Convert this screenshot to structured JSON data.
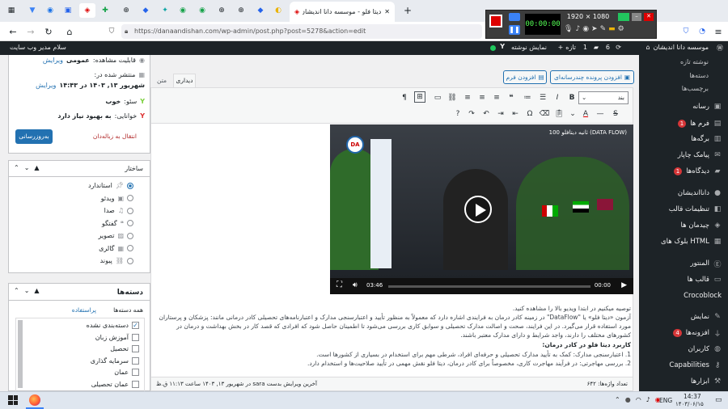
{
  "browser": {
    "active_tab_title": "دیتا فلو - موسسه دانا اندیشان",
    "url": "https://danaandishan.com/wp-admin/post.php?post=5278&action=edit"
  },
  "recorder": {
    "resolution": "1920 × 1080",
    "timer": "00:00:00"
  },
  "adminbar": {
    "site": "موسسه دانا اندیشان",
    "updates": "6",
    "comments": "1",
    "new": "تازه",
    "view": "نمایش نوشته",
    "greeting": "سلام مدیر وب سایت"
  },
  "menu": {
    "sub_all": "نوشته تازه",
    "sub_cat": "دسته‌ها",
    "sub_tags": "برچسب‌ها",
    "media": "رسانه",
    "forms": "فرم ها",
    "forms_badge": "1",
    "pages": "برگه‌ها",
    "sms": "پیامک چاپار",
    "comments": "دیدگاه‌ها",
    "comments_badge": "1",
    "danaandishan": "دانااندیشان",
    "theme_settings": "تنظیمات قالب",
    "widgets": "چیدمان ها",
    "html_blocks": "بلوک های HTML",
    "mentor": "المنتور",
    "templates": "قالب ها",
    "crocoblock": "Crocoblock",
    "appearance": "نمایش",
    "plugins": "افزونه‌ها",
    "plugins_badge": "4",
    "users": "کاربران",
    "capabilities": "Capabilities",
    "tools": "ابزارها"
  },
  "publish": {
    "visibility_label": "قابلیت مشاهده:",
    "visibility_value": "عمومی",
    "edit": "ویرایش",
    "published_label": "منتشر شده در:",
    "published_value": "شهریور ۱۳, ۱۴۰۳ در ۱۴:۴۳",
    "seo_label": "سئو:",
    "seo_value": "خوب",
    "readability_label": "خوانایی:",
    "readability_value": "به بهبود نیاز دارد",
    "trash": "انتقال به زباله‌دان",
    "update": "به‌روزرسانی"
  },
  "format": {
    "title": "ساختار",
    "options": [
      "استاندارد",
      "ویدئو",
      "صدا",
      "گفتگو",
      "تصویر",
      "گالری",
      "پیوند"
    ]
  },
  "categories": {
    "title": "دسته‌ها",
    "tab_all": "همه دسته‌ها",
    "tab_popular": "پراستفاده",
    "items": [
      "دسته‌بندی نشده",
      "آموزش زبان",
      "تحصیل",
      "سرمایه گذاری",
      "عمان",
      "عمان تحصیلی"
    ]
  },
  "editor": {
    "add_media": "افزودن پرونده چندرسانه‌ای",
    "add_form": "افزودن فرم",
    "tab_visual": "دیداری",
    "tab_text": "متن",
    "paragraph": "بند",
    "video_title": "100 ثانیه دیتافلو (DATA FLOW)",
    "video_elapsed": "00:00",
    "video_total": "03:46",
    "p1": "توصیه میکنیم در ابتدا ویدیو بالا را مشاهده کنید.",
    "p2": "آزمون «دیتا فلو» یا \"DataFlow\" در زمینه کادر درمان به فرایندی اشاره دارد که معمولاً به منظور تأیید و اعتبارسنجی مدارک و اعتبارنامه‌های تحصیلی کادر درمانی مانند: پزشکان و پرستاران مورد استفاده قرار می‌گیرد. در این فرایند، صحت و اصالت مدارک تحصیلی و سوابق کاری بررسی می‌شود تا اطمینان حاصل شود که افرادی که قصد کار در بخش بهداشت و درمان در کشورهای مختلف را دارند، واجد شرایط و دارای مدارک معتبر باشند.",
    "h1": "کاربرد دیتا فلو در کادر درمان:",
    "li1": "1. اعتبارسنجی مدارک: کمک به تأیید مدارک تحصیلی و حرفه‌ای افراد، شرطی مهم برای استخدام در بسیاری از کشورها است.",
    "li2": "2. بررسی مهاجرتی: در فرآیند مهاجرت کاری، مخصوصاً برای کادر درمان، دیتا فلو نقش مهمی در تأیید صلاحیت‌ها و استخدام دارد.",
    "word_count": "تعداد واژه‌ها: ۶۴۲",
    "last_edit": "آخرین ویرایش بدست sara در شهریور ۱۳, ۱۴۰۳ ساعت ۱۱:۱۳ ق.ظ"
  },
  "taskbar": {
    "time": "14:37",
    "date": "۱۴۰۳/۰۶/۱۵",
    "lang": "ENG"
  }
}
